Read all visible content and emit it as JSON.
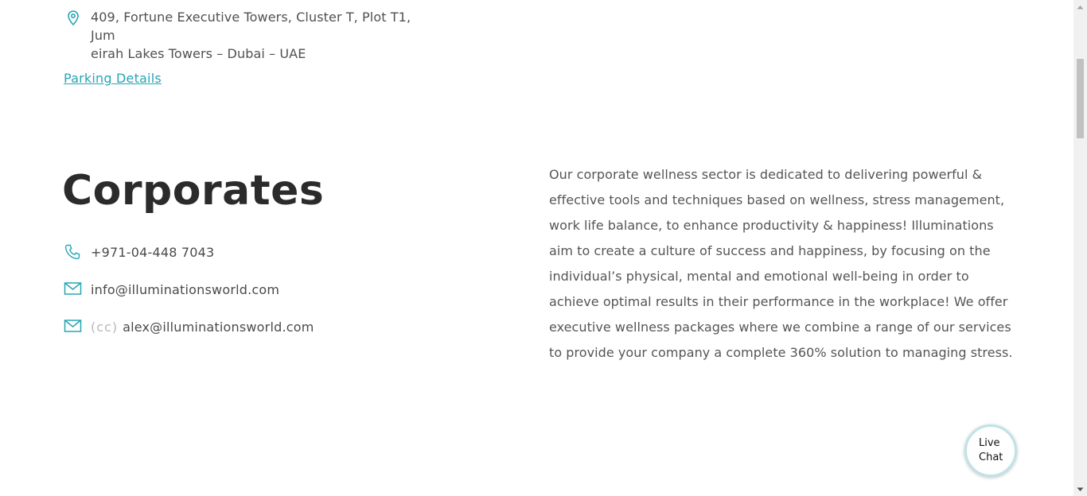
{
  "address": {
    "icon": "map-pin-icon",
    "line1": "409, Fortune Executive Towers, Cluster T, Plot T1, Jum",
    "line2": "eirah Lakes Towers – Dubai – UAE"
  },
  "parking_link": "Parking Details",
  "corporates": {
    "title": "Corporates",
    "phone": "+971-04-448 7043",
    "email": "info@illuminationsworld.com",
    "cc_label": "(cc)",
    "cc_email": "alex@illuminationsworld.com",
    "description": "Our corporate wellness sector is dedicated to delivering powerful & effective tools and techniques based on wellness, stress management, work life balance, to enhance productivity & happiness! Illuminations aim to create a culture of success and happiness, by focusing on the individual’s physical, mental and emotional well-being in order to achieve optimal results in their performance in the workplace! We offer executive wellness packages where we combine a range of our services to provide your company a complete 360% solution to managing stress."
  },
  "live_chat": {
    "line1": "Live",
    "line2": "Chat"
  },
  "colors": {
    "accent": "#26a5b5",
    "heading": "#2b2b2b",
    "body_text": "#555555"
  }
}
